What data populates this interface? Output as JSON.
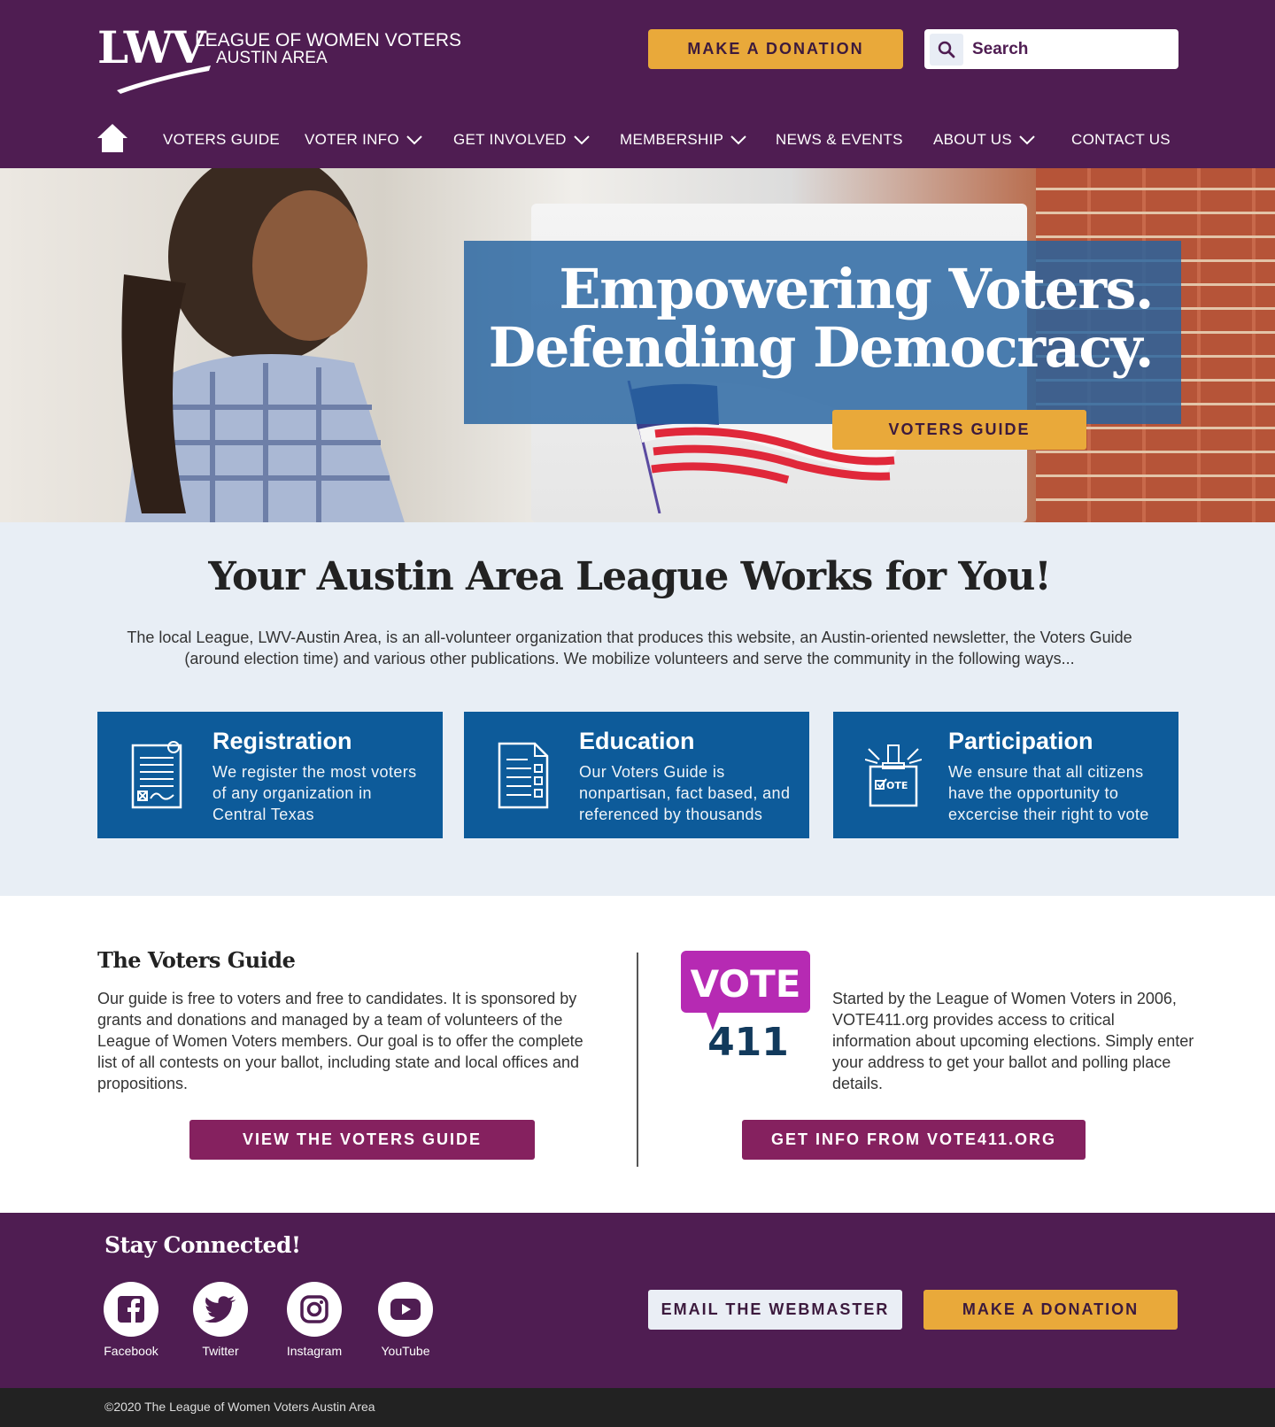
{
  "header": {
    "logo_mark": "LWV",
    "logo_line1": "LEAGUE OF WOMEN VOTERS",
    "logo_line2": "AUSTIN AREA",
    "donate_label": "MAKE A DONATION",
    "search_placeholder": "Search"
  },
  "nav": {
    "items": [
      {
        "label": "VOTERS GUIDE",
        "has_dropdown": false
      },
      {
        "label": "VOTER INFO",
        "has_dropdown": true
      },
      {
        "label": "GET INVOLVED",
        "has_dropdown": true
      },
      {
        "label": "MEMBERSHIP",
        "has_dropdown": true
      },
      {
        "label": "NEWS & EVENTS",
        "has_dropdown": false
      },
      {
        "label": "ABOUT US",
        "has_dropdown": true
      },
      {
        "label": "CONTACT US",
        "has_dropdown": false
      }
    ]
  },
  "hero": {
    "title_line1": "Empowering Voters.",
    "title_line2": "Defending Democracy.",
    "button_label": "VOTERS GUIDE"
  },
  "works": {
    "title": "Your Austin Area League Works for You!",
    "text": "The local League, LWV-Austin Area, is an all-volunteer organization that produces this website, an Austin-oriented newsletter, the Voters Guide (around election time) and various other publications. We mobilize volunteers and serve the community in the following ways...",
    "cards": [
      {
        "title": "Registration",
        "text": "We register the most voters of any organization in Central Texas",
        "icon": "registration-form-icon"
      },
      {
        "title": "Education",
        "text": "Our Voters Guide is nonpartisan, fact based, and referenced by thousands",
        "icon": "checklist-icon"
      },
      {
        "title": "Participation",
        "text": "We ensure that all citizens have the opportunity to excercise their right to vote",
        "icon": "ballot-box-icon"
      }
    ]
  },
  "guide": {
    "title": "The Voters Guide",
    "text": "Our guide is free to voters and free to candidates. It is sponsored by grants and donations and managed by a team of volunteers of the League of Women Voters members. Our goal is to offer the complete list of all contests on your ballot, including state and local offices and propositions.",
    "button_label": "VIEW THE VOTERS GUIDE"
  },
  "vote411": {
    "logo_top": "VOTE",
    "logo_bottom": "411",
    "text": "Started by the League of Women Voters in 2006, VOTE411.org provides access to critical information about upcoming elections. Simply enter your address to get your ballot and polling place details.",
    "button_label": "GET INFO FROM VOTE411.ORG"
  },
  "footer": {
    "title": "Stay Connected!",
    "social": [
      {
        "label": "Facebook",
        "icon": "facebook-icon"
      },
      {
        "label": "Twitter",
        "icon": "twitter-icon"
      },
      {
        "label": "Instagram",
        "icon": "instagram-icon"
      },
      {
        "label": "YouTube",
        "icon": "youtube-icon"
      }
    ],
    "email_label": "EMAIL THE WEBMASTER",
    "donate_label": "MAKE A DONATION",
    "copyright": "©2020 The League of Women Voters Austin Area"
  },
  "colors": {
    "brand_purple": "#4f1d52",
    "accent_gold": "#e9a93a",
    "card_blue": "#0d5b9a",
    "button_magenta": "#85215f",
    "vote411_magenta": "#b62ab3",
    "vote411_navy": "#123a5c"
  }
}
